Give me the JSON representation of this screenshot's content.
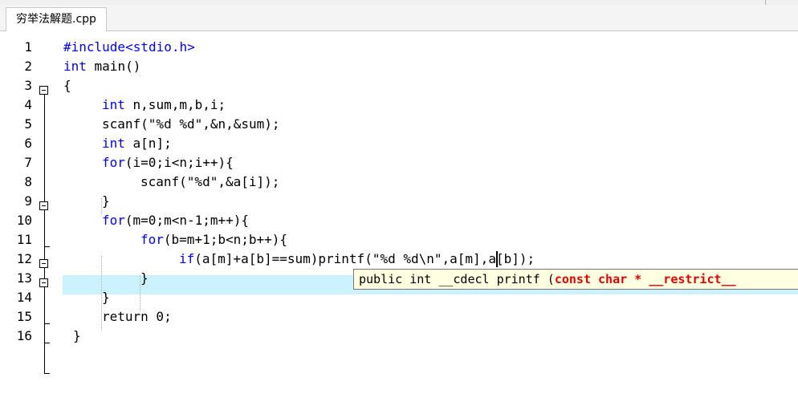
{
  "tab": {
    "title": "穷举法解题.cpp"
  },
  "editor": {
    "lines": [
      {
        "num": "1",
        "kw": "",
        "text": "#include<stdio.h>"
      },
      {
        "num": "2",
        "kw": "int",
        "text": " main()"
      },
      {
        "num": "3",
        "kw": "",
        "text": "{"
      },
      {
        "num": "4",
        "kw": "int",
        "text": " n,sum,m,b,i;"
      },
      {
        "num": "5",
        "kw": "",
        "text": "scanf(\"%d %d\",&n,&sum);"
      },
      {
        "num": "6",
        "kw": "int",
        "text": " a[n];"
      },
      {
        "num": "7",
        "kw": "for",
        "text": "(i=0;i<n;i++){"
      },
      {
        "num": "8",
        "kw": "",
        "text": "scanf(\"%d\",&a[i]);"
      },
      {
        "num": "9",
        "kw": "",
        "text": "}"
      },
      {
        "num": "10",
        "kw": "for",
        "text": "(m=0;m<n-1;m++){"
      },
      {
        "num": "11",
        "kw": "for",
        "text": "(b=m+1;b<n;b++){"
      },
      {
        "num": "12",
        "kw": "if",
        "text": "(a[m]+a[b]==sum)printf(\"%d %d\\n\",a[m],a[b]);"
      },
      {
        "num": "13",
        "kw": "",
        "text": "}"
      },
      {
        "num": "14",
        "kw": "",
        "text": "}"
      },
      {
        "num": "15",
        "kw": "",
        "text": "return 0;"
      },
      {
        "num": "16",
        "kw": "",
        "text": "}"
      }
    ]
  },
  "tooltip": {
    "prefix": "public int __cdecl printf (",
    "param": "const char * __restrict__"
  }
}
